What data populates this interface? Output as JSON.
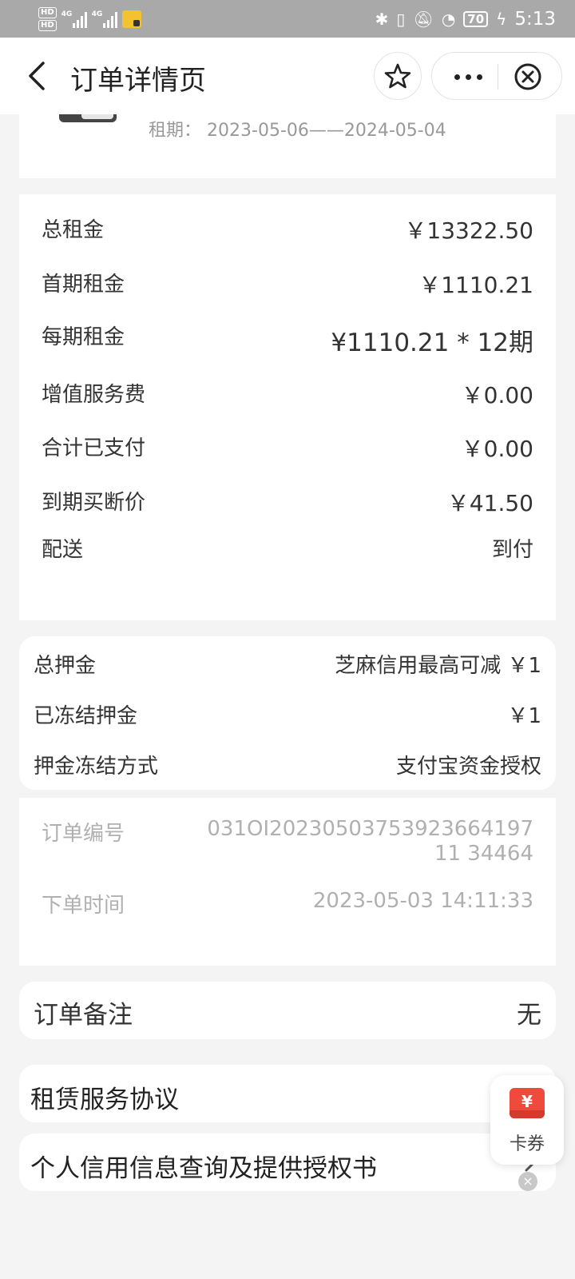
{
  "status_bar": {
    "hd1": "HD",
    "hd2": "HD",
    "net1": "4G",
    "net2": "4G",
    "battery": "70",
    "time": "5:13"
  },
  "nav": {
    "title": "订单详情页"
  },
  "product": {
    "lease_label": "租期：",
    "lease_value": "2023-05-06——2024-05-04"
  },
  "price": {
    "rows": [
      {
        "label": "总租金",
        "value": "￥13322.50"
      },
      {
        "label": "首期租金",
        "value": "￥1110.21"
      },
      {
        "label": "每期租金",
        "value": "¥1110.21 * 12期"
      },
      {
        "label": "增值服务费",
        "value": "￥0.00"
      },
      {
        "label": "合计已支付",
        "value": "￥0.00"
      },
      {
        "label": "到期买断价",
        "value": "￥41.50"
      },
      {
        "label": "配送",
        "value": "到付"
      }
    ]
  },
  "deposit": {
    "rows": [
      {
        "label": "总押金",
        "value": "芝麻信用最高可减 ￥1"
      },
      {
        "label": "已冻结押金",
        "value": "￥1"
      },
      {
        "label": "押金冻结方式",
        "value": "支付宝资金授权"
      }
    ]
  },
  "order_info": {
    "number_label": "订单编号",
    "number_value": "031OI2023050375392366419711 34464",
    "time_label": "下单时间",
    "time_value": "2023-05-03 14:11:33"
  },
  "note": {
    "label": "订单备注",
    "value": "无"
  },
  "links": [
    {
      "label": "租赁服务协议"
    },
    {
      "label": "个人信用信息查询及提供授权书"
    }
  ],
  "coupon": {
    "symbol": "¥",
    "label": "卡券",
    "close": "×"
  },
  "colors": {
    "status_bar": "#a9a9a9",
    "background": "#f4f4f4",
    "coupon_red": "#f04a3c"
  }
}
